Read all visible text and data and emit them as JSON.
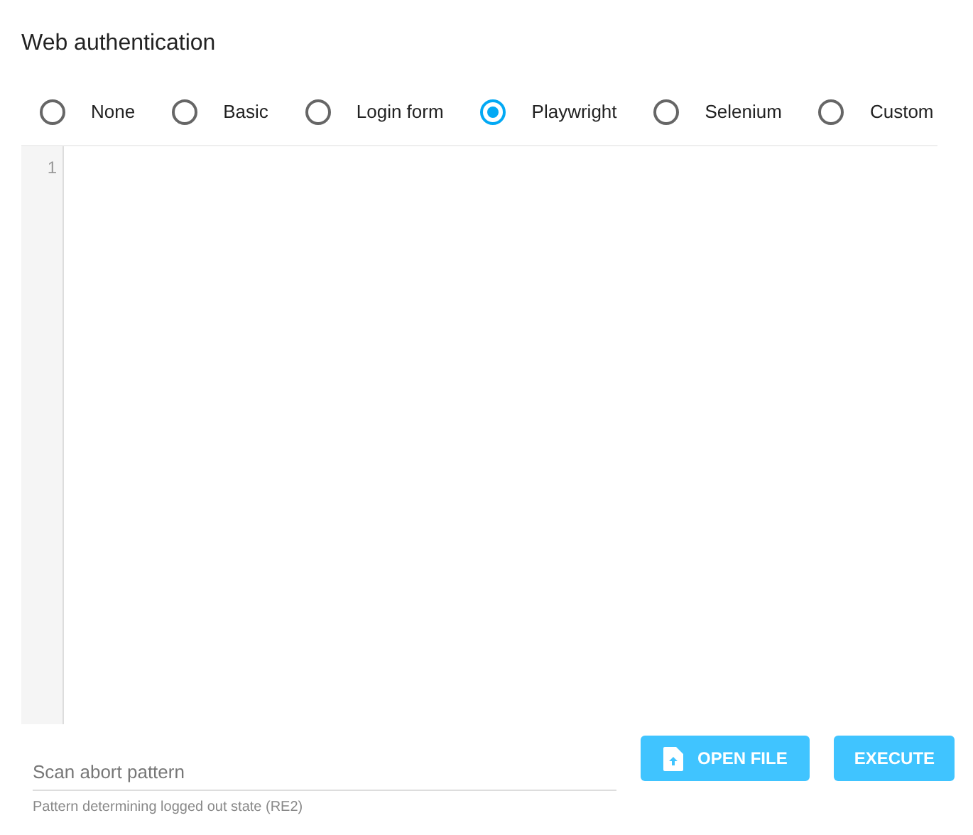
{
  "title": "Web authentication",
  "auth_methods": [
    {
      "label": "None",
      "selected": false
    },
    {
      "label": "Basic",
      "selected": false
    },
    {
      "label": "Login form",
      "selected": false
    },
    {
      "label": "Playwright",
      "selected": true
    },
    {
      "label": "Selenium",
      "selected": false
    },
    {
      "label": "Custom",
      "selected": false
    }
  ],
  "editor": {
    "line_numbers": [
      "1"
    ]
  },
  "scan_abort_pattern": {
    "placeholder": "Scan abort pattern",
    "helper": "Pattern determining logged out state (RE2)"
  },
  "buttons": [
    {
      "label": "OPEN FILE",
      "kind": "upload"
    },
    {
      "label": "EXECUTE",
      "kind": "plain"
    }
  ]
}
